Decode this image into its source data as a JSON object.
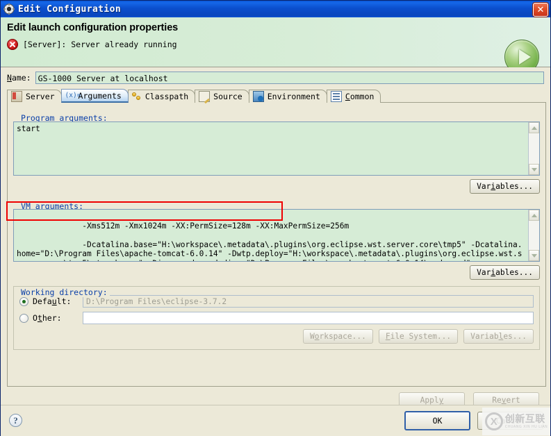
{
  "window": {
    "title": "Edit Configuration",
    "icon": "gear-icon",
    "close_label": "✕"
  },
  "header": {
    "title": "Edit launch configuration properties",
    "message": "[Server]: Server already running",
    "message_icon": "error-icon",
    "run_icon": "run-play-icon"
  },
  "name_field": {
    "label": "Name:",
    "value": "GS-1000 Server at localhost"
  },
  "tabs": [
    {
      "label": "Server",
      "icon": "server-icon",
      "active": false
    },
    {
      "label": "Arguments",
      "icon": "variable-icon",
      "active": true,
      "icon_text": "(x)="
    },
    {
      "label": "Classpath",
      "icon": "classpath-icon",
      "active": false
    },
    {
      "label": "Source",
      "icon": "source-icon",
      "active": false
    },
    {
      "label": "Environment",
      "icon": "environment-icon",
      "active": false
    },
    {
      "label": "Common",
      "icon": "common-icon",
      "active": false
    }
  ],
  "program_arguments": {
    "legend": "Program arguments:",
    "value": "start",
    "variables_button": "Variables..."
  },
  "vm_arguments": {
    "legend": "VM arguments:",
    "highlighted_line": "-Xms512m -Xmx1024m -XX:PermSize=128m -XX:MaxPermSize=256m",
    "rest": "-Dcatalina.base=\"H:\\workspace\\.metadata\\.plugins\\org.eclipse.wst.server.core\\tmp5\" -Dcatalina.home=\"D:\\Program Files\\apache-tomcat-6.0.14\" -Dwtp.deploy=\"H:\\workspace\\.metadata\\.plugins\\org.eclipse.wst.server.core\\tmp5\\wtpwebapps\" -Djava.endorsed.dirs=\"D:\\Program Files\\apache-tomcat-6.0.14\\endorsed\"",
    "variables_button": "Variables...",
    "highlight_color": "#ef0000"
  },
  "working_directory": {
    "legend": "Working directory:",
    "default_label": "Default:",
    "default_value": "D:\\Program Files\\eclipse-3.7.2",
    "default_selected": true,
    "other_label": "Other:",
    "other_value": "",
    "buttons": [
      "Workspace...",
      "File System...",
      "Variables..."
    ]
  },
  "form_buttons": {
    "apply": "Apply",
    "revert": "Revert"
  },
  "footer": {
    "help_icon": "help-icon",
    "help_label": "?",
    "ok": "OK",
    "cancel": "Cancel"
  },
  "watermark": {
    "logo_letter": "X",
    "chinese": "创新互联",
    "pinyin": "CHUANG XIN HU LIAN"
  }
}
